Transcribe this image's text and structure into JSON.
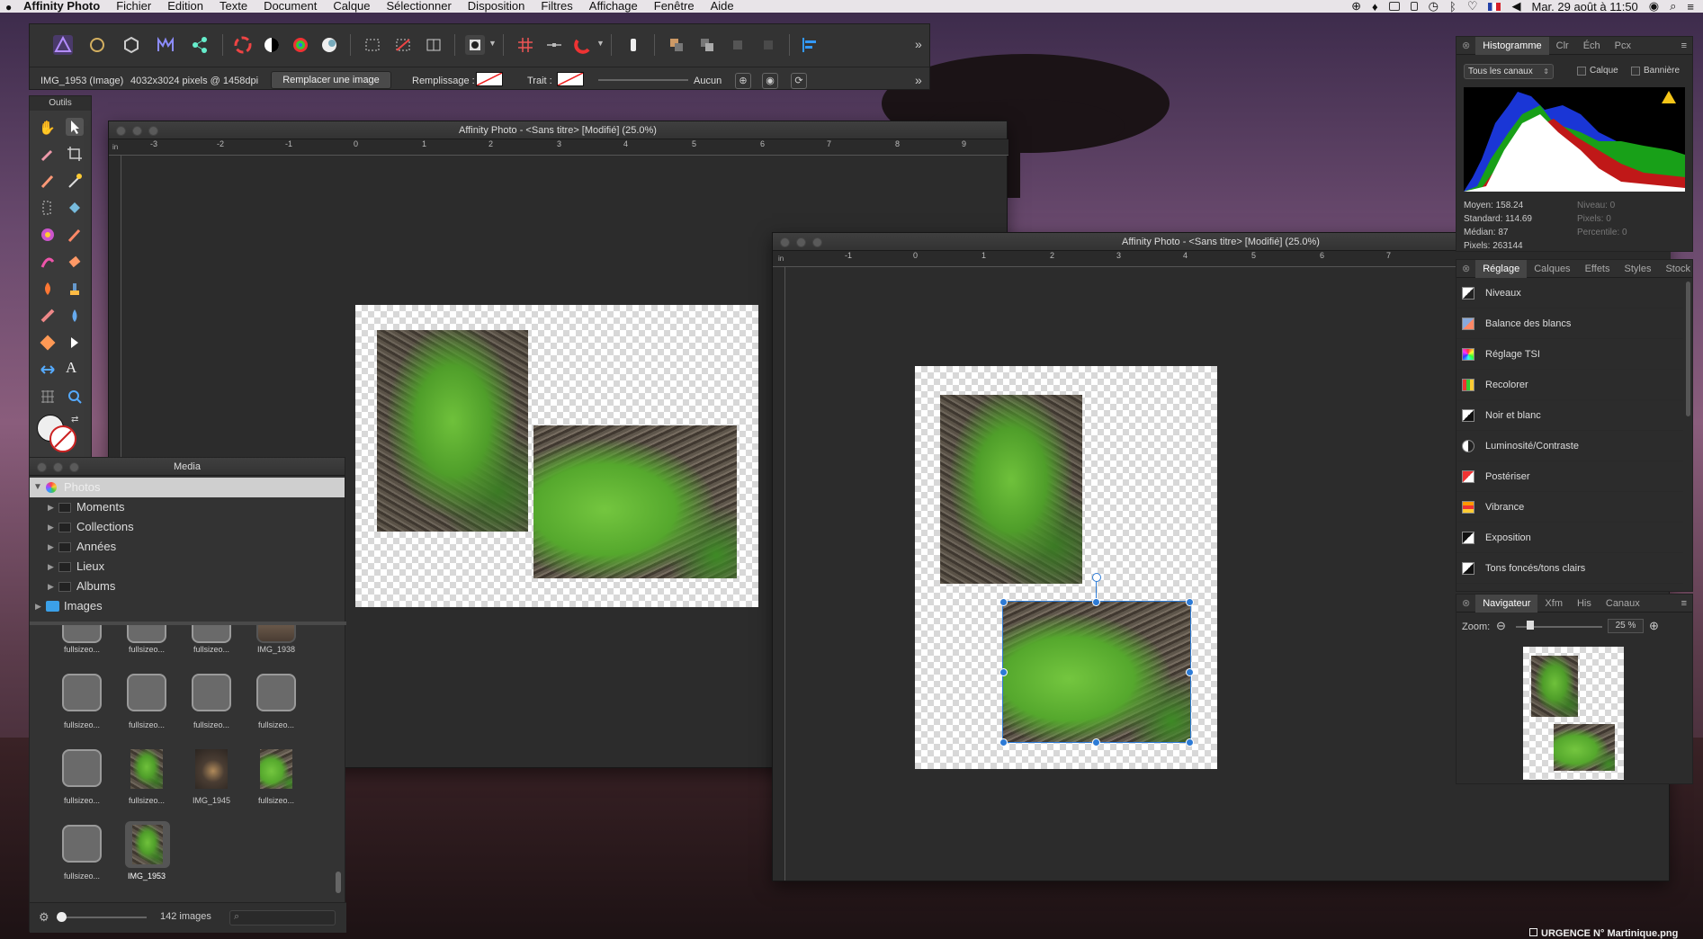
{
  "menubar": {
    "app": "Affinity Photo",
    "items": [
      "Fichier",
      "Edition",
      "Texte",
      "Document",
      "Calque",
      "Sélectionner",
      "Disposition",
      "Filtres",
      "Affichage",
      "Fenêtre",
      "Aide"
    ],
    "clock": "Mar. 29 août à 11:50"
  },
  "context_toolbar": {
    "layer_name": "IMG_1953 (Image)",
    "dimensions": "4032x3024 pixels @ 1458dpi",
    "replace_button": "Remplacer une image",
    "fill_label": "Remplissage :",
    "stroke_label": "Trait :",
    "stroke_value": "Aucun"
  },
  "tools_panel": {
    "title": "Outils"
  },
  "window1": {
    "title": "Affinity Photo - <Sans titre> [Modifié] (25.0%)",
    "ruler_unit": "in",
    "ticks": [
      "-3",
      "-2",
      "-1",
      "0",
      "1",
      "2",
      "3",
      "4",
      "5",
      "6",
      "7",
      "8",
      "9"
    ]
  },
  "window2": {
    "title": "Affinity Photo - <Sans titre> [Modifié] (25.0%)",
    "ruler_unit": "in",
    "ticks": [
      "-1",
      "0",
      "1",
      "2",
      "3",
      "4",
      "5",
      "6",
      "7"
    ]
  },
  "media": {
    "title": "Media",
    "source": "Photos",
    "folders": [
      "Moments",
      "Collections",
      "Années",
      "Lieux",
      "Albums"
    ],
    "images_folder": "Images",
    "thumbs": [
      [
        "fullsizeo...",
        "fullsizeo...",
        "fullsizeo...",
        "IMG_1938"
      ],
      [
        "fullsizeo...",
        "fullsizeo...",
        "fullsizeo...",
        "fullsizeo..."
      ],
      [
        "fullsizeo...",
        "fullsizeo...",
        "IMG_1945",
        "fullsizeo..."
      ],
      [
        "fullsizeo...",
        "IMG_1953"
      ]
    ],
    "count": "142 images"
  },
  "histogram": {
    "tabs": [
      "Histogramme",
      "Clr",
      "Éch",
      "Pcx"
    ],
    "channel": "Tous les canaux",
    "layer_checkbox": "Calque",
    "banner_checkbox": "Bannière",
    "stats_left": [
      "Moyen: 158.24",
      "Standard: 114.69",
      "Médian: 87",
      "Pixels: 263144"
    ],
    "stats_right": [
      "Niveau: 0",
      "Pixels: 0",
      "Percentile: 0"
    ]
  },
  "adjustments": {
    "tabs": [
      "Réglage",
      "Calques",
      "Effets",
      "Styles",
      "Stock"
    ],
    "items": [
      "Niveaux",
      "Balance des blancs",
      "Réglage TSI",
      "Recolorer",
      "Noir et blanc",
      "Luminosité/Contraste",
      "Postériser",
      "Vibrance",
      "Exposition",
      "Tons foncés/tons clairs"
    ]
  },
  "navigator": {
    "tabs": [
      "Navigateur",
      "Xfm",
      "His",
      "Canaux"
    ],
    "zoom_label": "Zoom:",
    "zoom_value": "25 %"
  },
  "dock_hint": "URGENCE N° Martinique.png",
  "colors": {
    "accent": "#2d7bd6",
    "panel": "#3a3a3a",
    "canvas": "#2c2c2c"
  }
}
